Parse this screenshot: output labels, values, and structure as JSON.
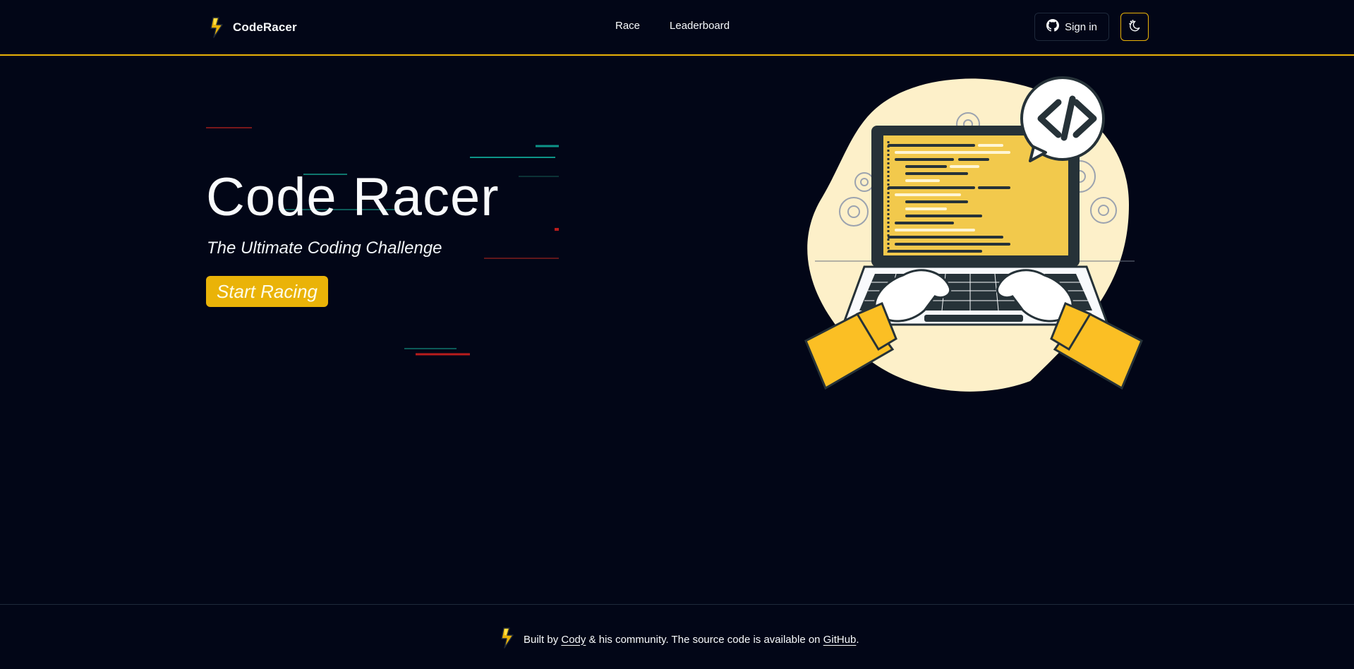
{
  "header": {
    "brand": "CodeRacer",
    "nav": [
      {
        "label": "Race"
      },
      {
        "label": "Leaderboard"
      }
    ],
    "signin_label": "Sign in",
    "theme_toggle_icon": "moon-stars-icon"
  },
  "hero": {
    "title": "Code Racer",
    "subtitle": "The Ultimate Coding Challenge",
    "cta_label": "Start Racing",
    "illustration": "developer-typing-on-laptop-illustration"
  },
  "footer": {
    "prefix": "Built by",
    "author_link": "Cody",
    "middle": "& his community. The source code is available on",
    "repo_link": "GitHub",
    "suffix": "."
  },
  "colors": {
    "background": "#020617",
    "accent": "#eab308",
    "border": "#1e293b",
    "text": "#f8fafc",
    "teal_streak": "#0d9488",
    "red_streak": "#b91c1c"
  },
  "icons": [
    "lightning-bolt-icon",
    "github-icon",
    "moon-stars-icon",
    "code-bracket-icon"
  ]
}
